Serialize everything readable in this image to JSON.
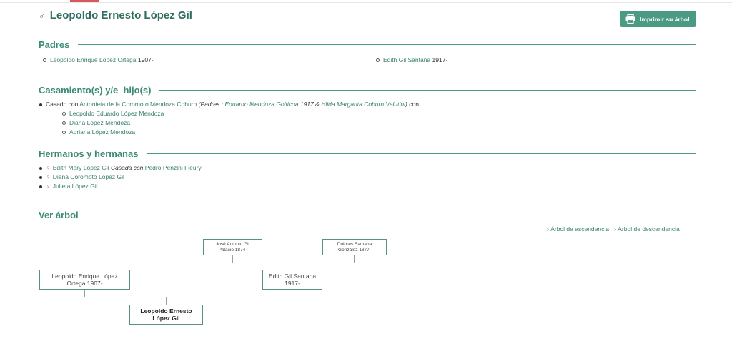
{
  "person": {
    "symbol": "♂",
    "name": "Leopoldo Ernesto López Gil"
  },
  "print_button": {
    "label": "Imprimir su árbol"
  },
  "sections": {
    "parents": "Padres",
    "marriages": "Casamiento(s) y/e  hijo(s)",
    "siblings": "Hermanos y hermanas",
    "tree": "Ver árbol"
  },
  "parents": [
    {
      "name": "Leopoldo Enrique López Ortega",
      "years": "1907-"
    },
    {
      "name": "Edith Gil Santana",
      "years": "1917-"
    }
  ],
  "marriage": {
    "prefix": "Casado con",
    "spouse": "Antonieta de la Coromoto Mendoza Coburn",
    "open": "(",
    "padres_label": "Padres",
    "sep": " : ",
    "father": "Eduardo Mendoza Goiticoa",
    "father_year": "1917",
    "amp": " & ",
    "mother": "Hilda Margarita Coburn Velutini",
    "close": ")",
    "con": "con",
    "children": [
      "Leopoldo Eduardo López Mendoza",
      "Diana López Mendoza",
      "Adriana López Mendoza"
    ]
  },
  "siblings": [
    {
      "name": "Edith Mary López Gil",
      "note": "Casada con",
      "spouse": "Pedro Penzini Fleury"
    },
    {
      "name": "Diana Coromoto López Gil"
    },
    {
      "name": "Julieta López Gil"
    }
  ],
  "tree_links": {
    "ascendencia": "Árbol de ascendencia",
    "descendencia": "Árbol de descendencia"
  },
  "tree_nodes": {
    "gf_line1": "José Antonio Gil",
    "gf_line2": "Palacio 1874-",
    "gm_line1": "Dolores Santana",
    "gm_line2": "González 1877-",
    "father_line1": "Leopoldo Enrique López",
    "father_line2": "Ortega 1907-",
    "mother_line1": "Edith Gil Santana",
    "mother_line2": "1917-",
    "self_line1": "Leopoldo Ernesto",
    "self_line2": "López Gil"
  },
  "colors": {
    "accent": "#3a8a76",
    "button": "#4a9a84",
    "female": "#d05a86",
    "top_accent": "#d65a5a"
  }
}
